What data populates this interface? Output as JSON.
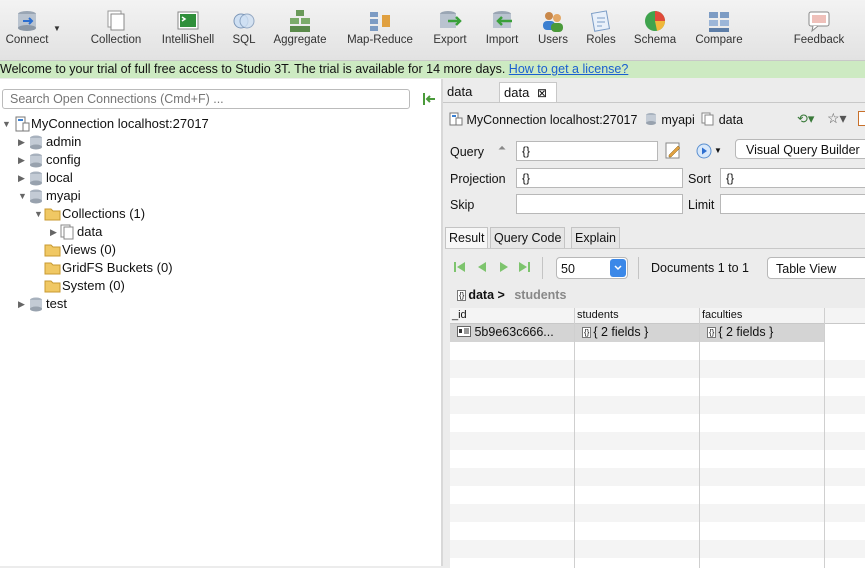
{
  "toolbar": {
    "buttons": [
      {
        "label": "Connect",
        "icon": "connect-icon"
      },
      {
        "label": "Collection",
        "icon": "collection-icon"
      },
      {
        "label": "IntelliShell",
        "icon": "intellishell-icon"
      },
      {
        "label": "SQL",
        "icon": "sql-icon"
      },
      {
        "label": "Aggregate",
        "icon": "aggregate-icon"
      },
      {
        "label": "Map-Reduce",
        "icon": "map-reduce-icon"
      },
      {
        "label": "Export",
        "icon": "export-icon"
      },
      {
        "label": "Import",
        "icon": "import-icon"
      },
      {
        "label": "Users",
        "icon": "users-icon"
      },
      {
        "label": "Roles",
        "icon": "roles-icon"
      },
      {
        "label": "Schema",
        "icon": "schema-icon"
      },
      {
        "label": "Compare",
        "icon": "compare-icon"
      },
      {
        "label": "Feedback",
        "icon": "feedback-icon"
      }
    ]
  },
  "banner": {
    "text": "Welcome to your trial of full free access to Studio 3T. The trial is available for 14 more days. ",
    "link": "How to get a license?"
  },
  "sidebar": {
    "search_placeholder": "Search Open Connections (Cmd+F) ...",
    "tree": {
      "connection": "MyConnection localhost:27017",
      "databases": [
        "admin",
        "config",
        "local",
        "myapi",
        "test"
      ],
      "collections": "Collections (1)",
      "collection_item": "data",
      "views": "Views (0)",
      "gridfs": "GridFS Buckets (0)",
      "system": "System (0)"
    }
  },
  "tabs": [
    {
      "label": "data",
      "active": false
    },
    {
      "label": "data",
      "active": true
    }
  ],
  "breadcrumb": {
    "connection": "MyConnection localhost:27017",
    "database": "myapi",
    "collection": "data"
  },
  "query": {
    "query_label": "Query",
    "query_value": "{}",
    "visual_builder": "Visual Query Builder",
    "projection_label": "Projection",
    "projection_value": "{}",
    "sort_label": "Sort",
    "sort_value": "{}",
    "skip_label": "Skip",
    "skip_value": "",
    "limit_label": "Limit",
    "limit_value": ""
  },
  "result_tabs": [
    "Result",
    "Query Code",
    "Explain"
  ],
  "results": {
    "page_size": "50",
    "docs_count": "Documents 1 to 1",
    "view_mode": "Table View",
    "path_root": "data",
    "path_sep": ">",
    "path_child": "students",
    "columns": [
      "_id",
      "students",
      "faculties"
    ],
    "rows": [
      {
        "id": "5b9e63c666...",
        "students": "{ 2 fields }",
        "faculties": "{ 2 fields }"
      }
    ]
  },
  "colors": {
    "banner_bg": "#cdeac2",
    "link": "#1a5fd0",
    "selection_row": "#d4d4d4",
    "accent_blue": "#3b88e8"
  }
}
